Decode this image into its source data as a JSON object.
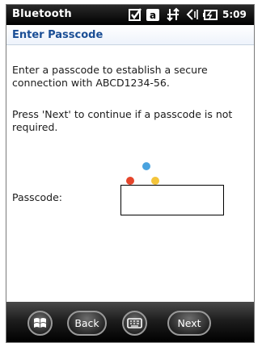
{
  "status_bar": {
    "app_title": "Bluetooth",
    "icons": [
      "checkbox-icon",
      "keyboard-a-icon",
      "connectivity-icon",
      "speaker-icon",
      "battery-icon"
    ],
    "time": "5:09"
  },
  "header": {
    "title": "Enter Passcode"
  },
  "main": {
    "instructions": "Enter a passcode to establish a secure connection with ABCD1234-56.",
    "hint": "Press 'Next' to continue if a passcode is not required.",
    "passcode_label": "Passcode:",
    "passcode_value": ""
  },
  "bottom_bar": {
    "back_label": "Back",
    "next_label": "Next",
    "icons": [
      "windows-start-icon",
      "keyboard-icon"
    ]
  },
  "colors": {
    "status_bar_bg": "#000000",
    "title_blue": "#1a4e95",
    "dot_blue": "#4aa3df",
    "dot_red": "#e5452b",
    "dot_yellow": "#f4c43a",
    "dot_green": "#6cb33f"
  }
}
